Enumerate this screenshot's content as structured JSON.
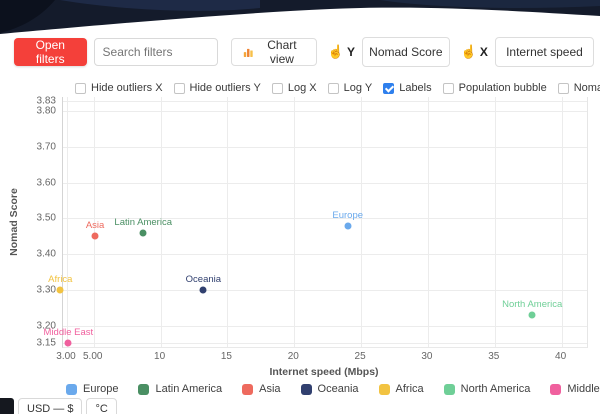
{
  "toolbar": {
    "open_filters": "Open filters",
    "search_placeholder": "Search filters",
    "chart_view": "Chart view",
    "y_selector": {
      "axis": "Y",
      "value": "Nomad Score"
    },
    "x_selector": {
      "axis": "X",
      "value": "Internet speed"
    }
  },
  "checkboxes": [
    {
      "label": "Hide outliers X",
      "checked": false
    },
    {
      "label": "Hide outliers Y",
      "checked": false
    },
    {
      "label": "Log X",
      "checked": false
    },
    {
      "label": "Log Y",
      "checked": false
    },
    {
      "label": "Labels",
      "checked": true
    },
    {
      "label": "Population bubble",
      "checked": false
    },
    {
      "label": "Nomad Score bubble",
      "checked": false
    }
  ],
  "chart_data": {
    "type": "scatter",
    "title": "",
    "xlabel": "Internet speed (Mbps)",
    "ylabel": "Nomad Score",
    "xlim": [
      2.7,
      41.9
    ],
    "ylim": [
      3.14,
      3.84
    ],
    "grid": true,
    "legend_position": "bottom",
    "x_ticks": [
      {
        "value": 3,
        "label": "3.00"
      },
      {
        "value": 5,
        "label": "5.00"
      },
      {
        "value": 10,
        "label": "10"
      },
      {
        "value": 15,
        "label": "15"
      },
      {
        "value": 20,
        "label": "20"
      },
      {
        "value": 25,
        "label": "25"
      },
      {
        "value": 30,
        "label": "30"
      },
      {
        "value": 35,
        "label": "35"
      },
      {
        "value": 40,
        "label": "40"
      }
    ],
    "y_ticks": [
      {
        "value": 3.83,
        "label": "3.83"
      },
      {
        "value": 3.8,
        "label": "3.80"
      },
      {
        "value": 3.7,
        "label": "3.70"
      },
      {
        "value": 3.6,
        "label": "3.60"
      },
      {
        "value": 3.5,
        "label": "3.50"
      },
      {
        "value": 3.4,
        "label": "3.40"
      },
      {
        "value": 3.3,
        "label": "3.30"
      },
      {
        "value": 3.2,
        "label": "3.20"
      },
      {
        "value": 3.15,
        "label": "3.15"
      }
    ],
    "points": [
      {
        "name": "Europe",
        "x": 24,
        "y": 3.48,
        "color": "#6aa9ec"
      },
      {
        "name": "Latin America",
        "x": 8.7,
        "y": 3.46,
        "color": "#4a8f63"
      },
      {
        "name": "Asia",
        "x": 5.1,
        "y": 3.45,
        "color": "#ee6a5e"
      },
      {
        "name": "Oceania",
        "x": 13.2,
        "y": 3.3,
        "color": "#31406f"
      },
      {
        "name": "Africa",
        "x": 2.5,
        "y": 3.3,
        "color": "#f2c341"
      },
      {
        "name": "North America",
        "x": 37.8,
        "y": 3.23,
        "color": "#6fcf97"
      },
      {
        "name": "Middle East",
        "x": 3.1,
        "y": 3.15,
        "color": "#f0609e"
      }
    ]
  },
  "legend": [
    {
      "label": "Europe",
      "color": "#6aa9ec"
    },
    {
      "label": "Latin America",
      "color": "#4a8f63"
    },
    {
      "label": "Asia",
      "color": "#ee6a5e"
    },
    {
      "label": "Oceania",
      "color": "#31406f"
    },
    {
      "label": "Africa",
      "color": "#f2c341"
    },
    {
      "label": "North America",
      "color": "#6fcf97"
    },
    {
      "label": "Middle East",
      "color": "#f0609e"
    }
  ],
  "footer": {
    "currency": "USD — $",
    "temperature": "°C"
  },
  "colors": {
    "accent_red": "#f4403a",
    "checkbox_checked": "#2f80ed",
    "banner_bg": "#141b2b"
  }
}
